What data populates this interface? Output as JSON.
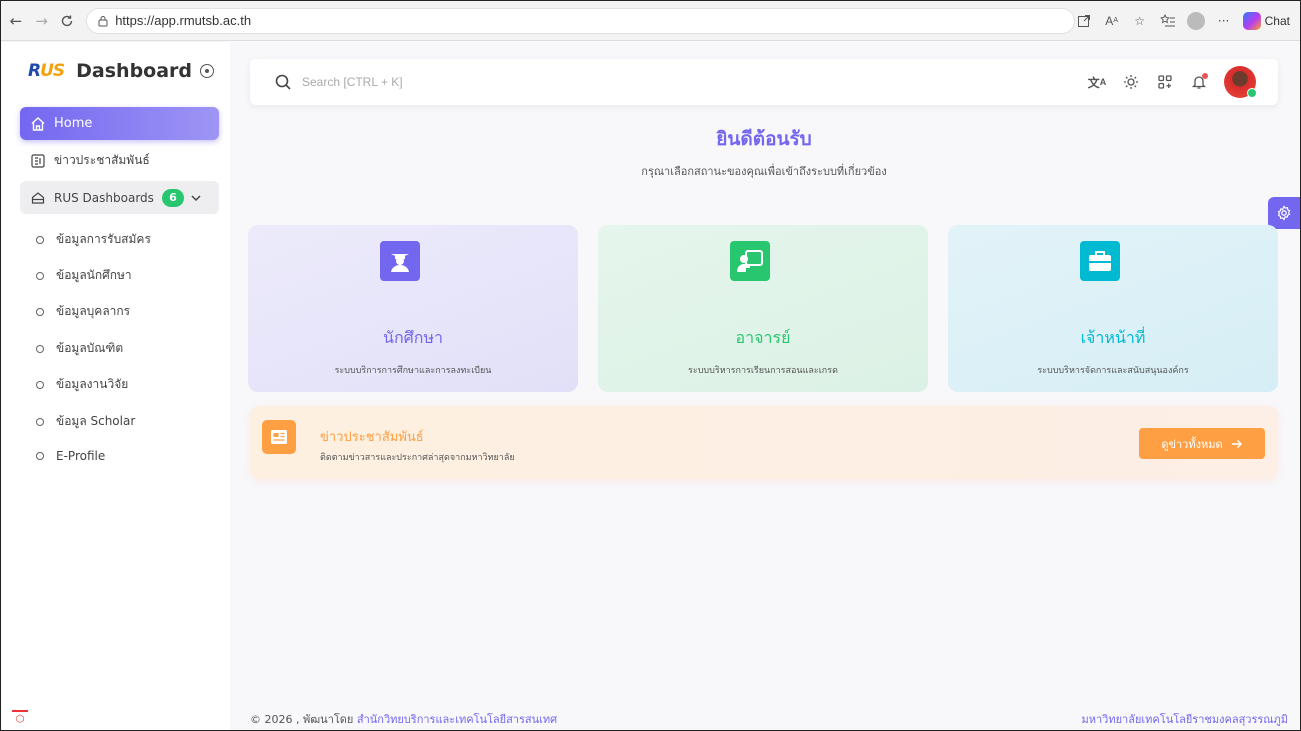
{
  "browser": {
    "url": "https://app.rmutsb.ac.th",
    "chat_label": "Chat"
  },
  "sidebar": {
    "logo_r": "R",
    "logo_us": "US",
    "title": "Dashboard",
    "home_label": "Home",
    "news_label": "ข่าวประชาสัมพันธ์",
    "group_label": "RUS Dashboards",
    "group_count": "6",
    "sub_items": [
      "ข้อมูลการรับสมัคร",
      "ข้อมูลนักศึกษา",
      "ข้อมูลบุคลากร",
      "ข้อมูลบัณฑิต",
      "ข้อมูลงานวิจัย",
      "ข้อมูล Scholar",
      "E-Profile"
    ]
  },
  "search": {
    "placeholder": "Search [CTRL + K]"
  },
  "main": {
    "welcome": "ยินดีต้อนรับ",
    "welcome_sub": "กรุณาเลือกสถานะของคุณเพื่อเข้าถึงระบบที่เกี่ยวข้อง",
    "cards": [
      {
        "title": "นักศึกษา",
        "desc": "ระบบบริการการศึกษาและการลงทะเบียน",
        "color": "#7367f0"
      },
      {
        "title": "อาจารย์",
        "desc": "ระบบบริหารการเรียนการสอนและเกรด",
        "color": "#28c76f"
      },
      {
        "title": "เจ้าหน้าที่",
        "desc": "ระบบบริหารจัดการและสนับสนุนองค์กร",
        "color": "#00bad1"
      }
    ],
    "news": {
      "title": "ข่าวประชาสัมพันธ์",
      "desc": "ติดตามข่าวสารและประกาศล่าสุดจากมหาวิทยาลัย",
      "button": "ดูข่าวทั้งหมด",
      "color": "#ff9f43"
    }
  },
  "footer": {
    "prefix": "© 2026 , พัฒนาโดย",
    "link": "สำนักวิทยบริการและเทคโนโลยีสารสนเทศ",
    "right": "มหาวิทยาลัยเทคโนโลยีราชมงคลสุวรรณภูมิ"
  }
}
